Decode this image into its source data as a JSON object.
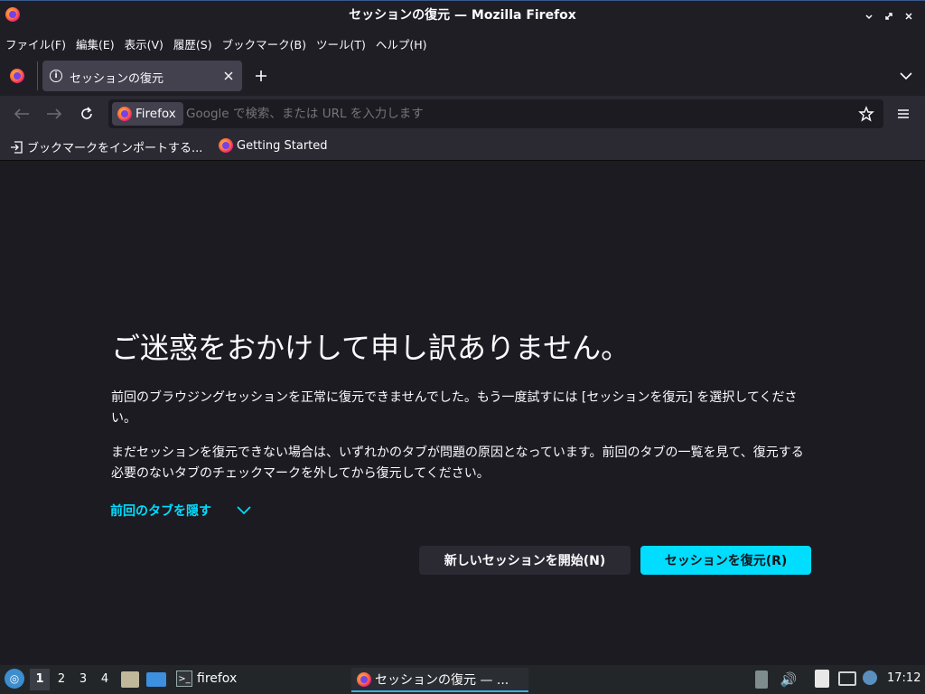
{
  "window": {
    "title": "セッションの復元 — Mozilla Firefox"
  },
  "menubar": {
    "items": [
      "ファイル(F)",
      "編集(E)",
      "表示(V)",
      "履歴(S)",
      "ブックマーク(B)",
      "ツール(T)",
      "ヘルプ(H)"
    ]
  },
  "tabs": [
    {
      "label": "セッションの復元",
      "icon": "info-icon"
    }
  ],
  "urlbar": {
    "identity_label": "Firefox",
    "placeholder": "Google で検索、または URL を入力します"
  },
  "bookmarks": [
    {
      "label": "ブックマークをインポートする...",
      "icon": "import-icon"
    },
    {
      "label": "Getting Started",
      "icon": "firefox-icon"
    }
  ],
  "content": {
    "heading": "ご迷惑をおかけして申し訳ありません。",
    "para1": "前回のブラウジングセッションを正常に復元できませんでした。もう一度試すには [セッションを復元] を選択してください。",
    "para2": "まだセッションを復元できない場合は、いずれかのタブが問題の原因となっています。前回のタブの一覧を見て、復元する必要のないタブのチェックマークを外してから復元してください。",
    "toggle_label": "前回のタブを隠す",
    "new_session_button": "新しいセッションを開始(N)",
    "restore_button": "セッションを復元(R)"
  },
  "taskbar": {
    "workspaces": [
      "1",
      "2",
      "3",
      "4"
    ],
    "active_workspace": "1",
    "terminal_label": "firefox",
    "window_button": "セッションの復元 — ...",
    "clock": "17:12"
  },
  "colors": {
    "accent": "#00ddff",
    "bg": "#1c1b22",
    "toolbar": "#2b2a33",
    "button": "#2b2a33"
  }
}
